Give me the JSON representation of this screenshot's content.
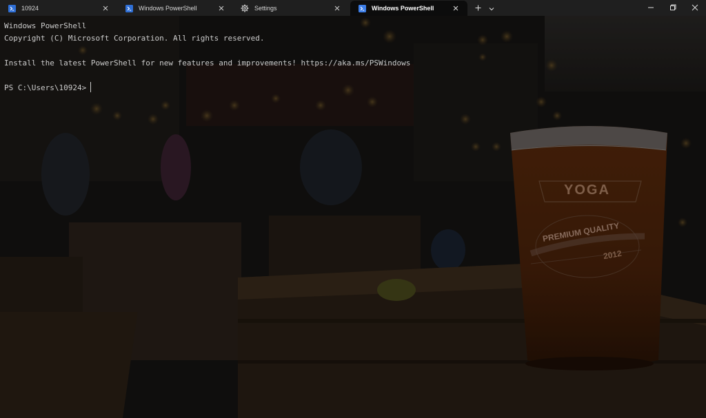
{
  "tabs": [
    {
      "label": "10924",
      "icon": "powershell-icon",
      "active": false
    },
    {
      "label": "Windows PowerShell",
      "icon": "powershell-icon",
      "active": false
    },
    {
      "label": "Settings",
      "icon": "gear-icon",
      "active": false
    },
    {
      "label": "Windows PowerShell",
      "icon": "powershell-icon",
      "active": true
    }
  ],
  "toolbar": {
    "new_tab_icon": "plus-icon",
    "dropdown_icon": "chevron-down-icon"
  },
  "window_controls": {
    "minimize_icon": "minimize-icon",
    "restore_icon": "restore-icon",
    "close_icon": "close-icon"
  },
  "terminal": {
    "lines": [
      "Windows PowerShell",
      "Copyright (C) Microsoft Corporation. All rights reserved.",
      "",
      "Install the latest PowerShell for new features and improvements! https://aka.ms/PSWindows",
      ""
    ],
    "prompt": "PS C:\\Users\\10924>",
    "background_image": "beer-glass-photo",
    "glass_text": {
      "brand": "YOGA",
      "tagline": "PREMIUM QUALITY",
      "year": "2012"
    }
  },
  "colors": {
    "titlebar_bg": "#1f1f1f",
    "active_tab_bg": "#0c0c0c",
    "terminal_text": "#cccccc",
    "powershell_blue": "#3d7ee8"
  }
}
